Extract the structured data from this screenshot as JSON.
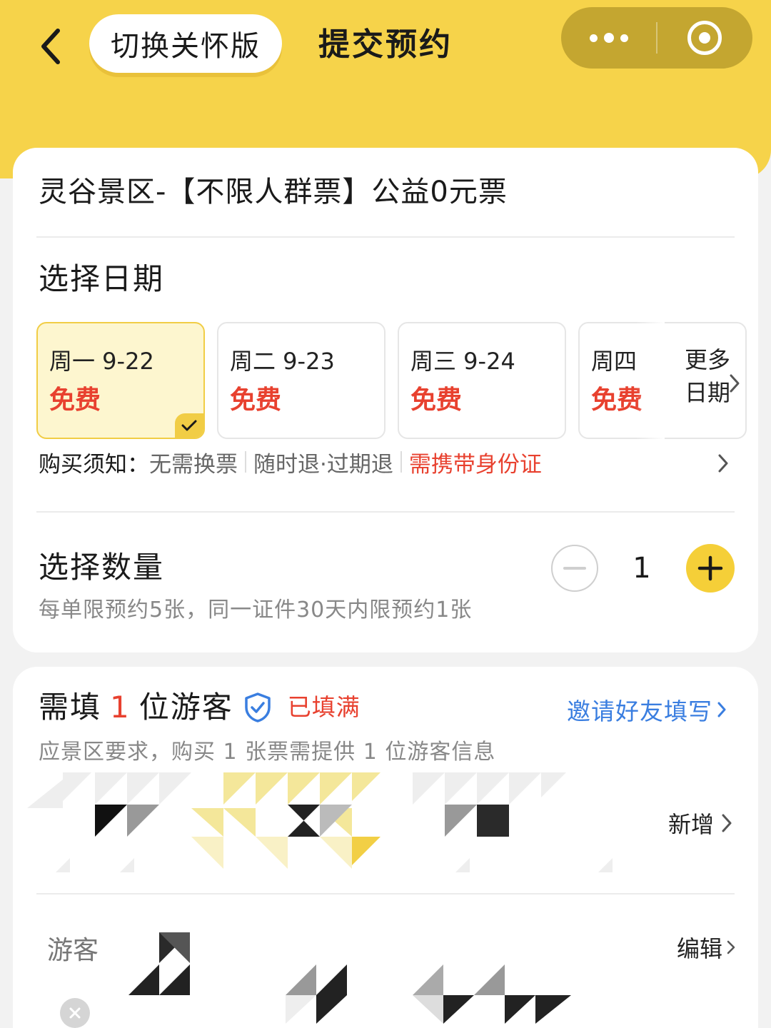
{
  "header": {
    "care_mode_label": "切换关怀版",
    "title": "提交预约",
    "brand_color": "#f6d34a"
  },
  "ticket": {
    "title": "灵谷景区-【不限人群票】公益0元票"
  },
  "date_section": {
    "title": "选择日期",
    "dates": [
      {
        "day": "周一 9-22",
        "price": "免费",
        "selected": true
      },
      {
        "day": "周二 9-23",
        "price": "免费",
        "selected": false
      },
      {
        "day": "周三 9-24",
        "price": "免费",
        "selected": false
      },
      {
        "day": "周四",
        "price": "免费",
        "selected": false
      }
    ],
    "more_label": "更多日期"
  },
  "notice": {
    "label": "购买须知：",
    "items": [
      "无需换票",
      "随时退·过期退"
    ],
    "highlight": "需携带身份证"
  },
  "quantity": {
    "title": "选择数量",
    "value": "1",
    "limit_text": "每单限预约5张，同一证件30天内限预约1张"
  },
  "visitors": {
    "need_prefix": "需填",
    "need_count": "1",
    "need_suffix": "位游客",
    "status": "已填满",
    "invite_label": "邀请好友填写",
    "subtitle": "应景区要求，购买 1 张票需提供 1 位游客信息",
    "add_label": "新增",
    "row_label": "游客",
    "edit_label": "编辑"
  },
  "colors": {
    "accent_yellow": "#f5cf38",
    "price_red": "#e8412f",
    "link_blue": "#3a7ee0"
  }
}
